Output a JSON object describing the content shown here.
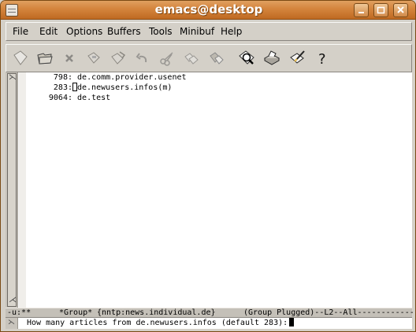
{
  "window": {
    "title": "emacs@desktop"
  },
  "menubar": {
    "items": [
      "File",
      "Edit",
      "Options",
      "Buffers",
      "Tools",
      "Minibuf",
      "Help"
    ]
  },
  "toolbar": {
    "items": [
      {
        "name": "new-file-icon"
      },
      {
        "name": "open-folder-icon"
      },
      {
        "name": "close-x-icon"
      },
      {
        "name": "save-disk-icon"
      },
      {
        "name": "save-as-icon"
      },
      {
        "name": "undo-icon"
      },
      {
        "name": "cut-scissors-icon"
      },
      {
        "name": "copy-icon"
      },
      {
        "name": "paste-icon"
      },
      {
        "name": "search-magnifier-icon"
      },
      {
        "name": "print-icon"
      },
      {
        "name": "preferences-icon"
      },
      {
        "name": "help-question-icon"
      }
    ]
  },
  "groups": [
    {
      "count": "798:",
      "name": "de.comm.provider.usenet",
      "cursor": false
    },
    {
      "count": "283:",
      "name": "de.newusers.infos(m)",
      "cursor": true
    },
    {
      "count": "9064:",
      "name": "de.test",
      "cursor": false
    }
  ],
  "modeline": {
    "status": "-u:**",
    "buffer": "*Group*",
    "server": "{nntp:news.individual.de}",
    "mode": "(Group Plugged)--L2--All-------------"
  },
  "minibuffer": {
    "prompt": "How many articles from de.newusers.infos (default 283):"
  }
}
